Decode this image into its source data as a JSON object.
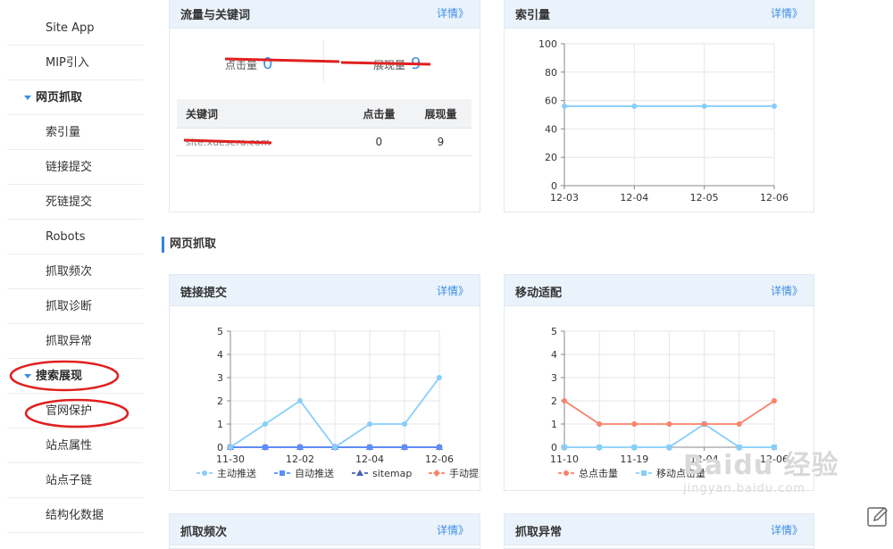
{
  "sidebar": {
    "items": [
      {
        "label": "Site App",
        "type": "item"
      },
      {
        "label": "MIP引入",
        "type": "item"
      },
      {
        "label": "网页抓取",
        "type": "group"
      },
      {
        "label": "索引量",
        "type": "item"
      },
      {
        "label": "链接提交",
        "type": "item"
      },
      {
        "label": "死链提交",
        "type": "item"
      },
      {
        "label": "Robots",
        "type": "item"
      },
      {
        "label": "抓取频次",
        "type": "item"
      },
      {
        "label": "抓取诊断",
        "type": "item"
      },
      {
        "label": "抓取异常",
        "type": "item"
      },
      {
        "label": "搜索展现",
        "type": "group"
      },
      {
        "label": "官网保护",
        "type": "item"
      },
      {
        "label": "站点属性",
        "type": "item"
      },
      {
        "label": "站点子链",
        "type": "item"
      },
      {
        "label": "结构化数据",
        "type": "item"
      }
    ]
  },
  "more_label": "详情》",
  "traffic_panel": {
    "title": "流量与关键词",
    "clicks_label": "点击量",
    "clicks_value": "0",
    "impressions_label": "展现量",
    "impressions_value": "9",
    "table": {
      "headers": [
        "关键词",
        "点击量",
        "展现量"
      ],
      "rows": [
        [
          "site:xuesera.com",
          "0",
          "9"
        ]
      ]
    }
  },
  "section": {
    "title": "网页抓取"
  },
  "bottom_panels": {
    "left_title": "抓取频次",
    "right_title": "抓取异常"
  },
  "watermark": {
    "line1": "Baidu 经验",
    "line2": "jingyan.baidu.com"
  },
  "colors": {
    "accent": "#3b8ee8",
    "light_blue": "#87cefa",
    "blue": "#5b8ff9",
    "orange": "#f7836b"
  },
  "chart_data": [
    {
      "type": "line",
      "title": "索引量",
      "categories": [
        "12-03",
        "12-04",
        "12-05",
        "12-06"
      ],
      "ylim": [
        0,
        100
      ],
      "yticks": [
        0,
        20,
        40,
        60,
        80,
        100
      ],
      "series": [
        {
          "values": [
            56,
            56,
            56,
            56
          ],
          "color": "#87cefa"
        }
      ]
    },
    {
      "type": "line",
      "title": "链接提交",
      "x": [
        "11-30",
        "",
        "12-02",
        "",
        "12-04",
        "",
        "12-06"
      ],
      "xlabels": [
        "11-30",
        "12-02",
        "12-04",
        "12-06"
      ],
      "ylim": [
        0,
        5
      ],
      "yticks": [
        0,
        1,
        2,
        3,
        4,
        5
      ],
      "series": [
        {
          "name": "主动推送",
          "values": [
            0,
            1,
            2,
            0,
            1,
            1,
            3
          ],
          "color": "#87cefa",
          "marker": "circle"
        },
        {
          "name": "自动推送",
          "values": [
            0,
            0,
            0,
            0,
            0,
            0,
            0
          ],
          "color": "#5b8ff9",
          "marker": "square"
        },
        {
          "name": "sitemap",
          "values": [
            0,
            0,
            0,
            0,
            0,
            0,
            0
          ],
          "color": "#4a63b8",
          "marker": "triangle"
        },
        {
          "name": "手动提交",
          "values": [
            0,
            0,
            0,
            0,
            0,
            0,
            0
          ],
          "color": "#f7836b",
          "marker": "diamond"
        }
      ]
    },
    {
      "type": "line",
      "title": "移动适配",
      "x": [
        "11-10",
        "",
        "11-19",
        "",
        "12-04",
        "",
        "12-06"
      ],
      "xlabels": [
        "11-10",
        "11-19",
        "12-04",
        "12-06"
      ],
      "ylim": [
        0,
        5
      ],
      "yticks": [
        0,
        1,
        2,
        3,
        4,
        5
      ],
      "series": [
        {
          "name": "总点击量",
          "values": [
            2,
            1,
            1,
            1,
            1,
            1,
            2
          ],
          "color": "#f7836b",
          "marker": "circle"
        },
        {
          "name": "移动点击量",
          "values": [
            0,
            0,
            0,
            0,
            1,
            0,
            0
          ],
          "color": "#87cefa",
          "marker": "square"
        }
      ]
    }
  ]
}
